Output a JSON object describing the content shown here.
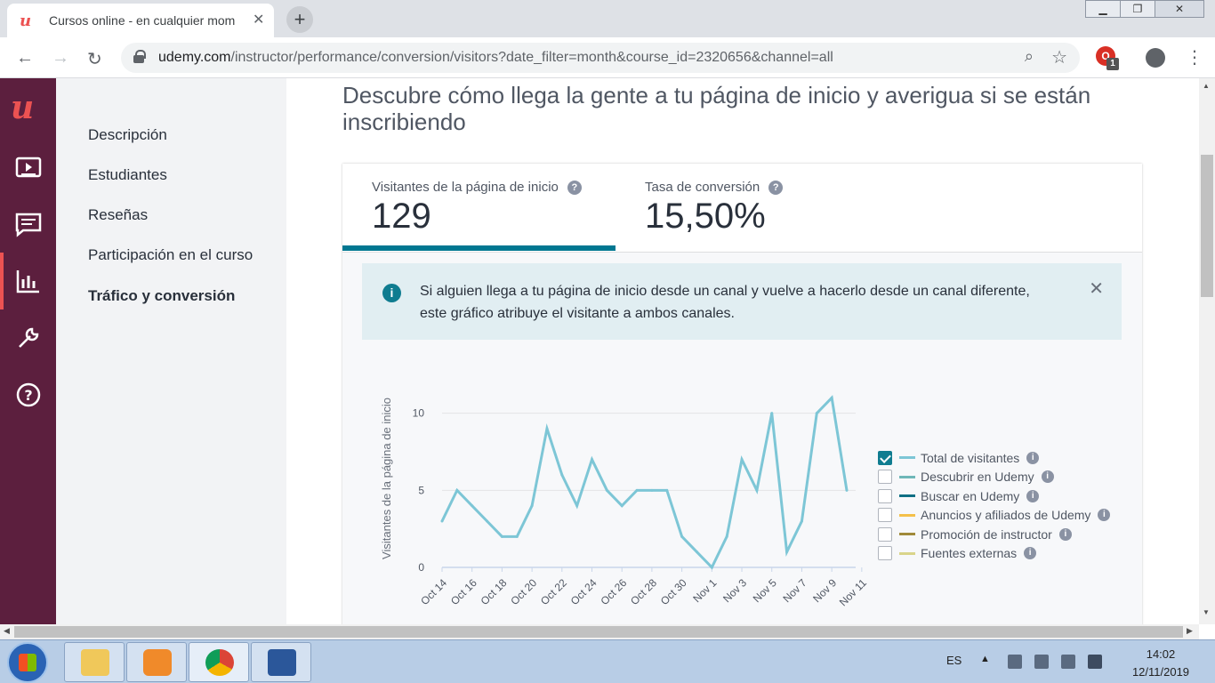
{
  "browser": {
    "tab_title": "Cursos online - en cualquier mom",
    "url_host": "udemy.com",
    "url_path": "/instructor/performance/conversion/visitors?date_filter=month&course_id=2320656&channel=all",
    "extension_badge": "1"
  },
  "nav": {
    "items": [
      {
        "label": "Descripción"
      },
      {
        "label": "Estudiantes"
      },
      {
        "label": "Reseñas"
      },
      {
        "label": "Participación en el curso"
      },
      {
        "label": "Tráfico y conversión"
      }
    ]
  },
  "main": {
    "headline": "Descubre cómo llega la gente a tu página de inicio y averigua si se están inscribiendo",
    "stats": [
      {
        "label": "Visitantes de la página de inicio",
        "value": "129"
      },
      {
        "label": "Tasa de conversión",
        "value": "15,50%"
      }
    ],
    "info": "Si alguien llega a tu página de inicio desde un canal y vuelve a hacerlo desde un canal diferente, este gráfico atribuye el visitante a ambos canales."
  },
  "chart_data": {
    "type": "line",
    "ylabel": "Visitantes de la página de inicio",
    "ylim": [
      0,
      10
    ],
    "yticks": [
      0,
      5,
      10
    ],
    "x_ticks": [
      "Oct 14",
      "Oct 16",
      "Oct 18",
      "Oct 20",
      "Oct 22",
      "Oct 24",
      "Oct 26",
      "Oct 28",
      "Oct 30",
      "Nov 1",
      "Nov 3",
      "Nov 5",
      "Nov 7",
      "Nov 9",
      "Nov 11"
    ],
    "x": [
      "Oct 14",
      "Oct 15",
      "Oct 16",
      "Oct 17",
      "Oct 18",
      "Oct 19",
      "Oct 20",
      "Oct 21",
      "Oct 22",
      "Oct 23",
      "Oct 24",
      "Oct 25",
      "Oct 26",
      "Oct 27",
      "Oct 28",
      "Oct 29",
      "Oct 30",
      "Oct 31",
      "Nov 1",
      "Nov 2",
      "Nov 3",
      "Nov 4",
      "Nov 5",
      "Nov 6",
      "Nov 7",
      "Nov 8",
      "Nov 9",
      "Nov 10"
    ],
    "series": [
      {
        "name": "Total de visitantes",
        "color": "#7dc6d6",
        "values": [
          3,
          5,
          4,
          3,
          2,
          2,
          4,
          9,
          6,
          4,
          7,
          5,
          4,
          5,
          5,
          5,
          2,
          1,
          0,
          2,
          7,
          5,
          10,
          1,
          3,
          10,
          11,
          5
        ]
      }
    ],
    "grid": true,
    "legend_position": "right",
    "legend": [
      {
        "label": "Total de visitantes",
        "color": "#7dc6d6",
        "checked": true
      },
      {
        "label": "Descubrir en Udemy",
        "color": "#6fb7b8",
        "checked": false
      },
      {
        "label": "Buscar en Udemy",
        "color": "#0f6f84",
        "checked": false
      },
      {
        "label": "Anuncios y afiliados de Udemy",
        "color": "#f4c04a",
        "checked": false
      },
      {
        "label": "Promoción de instructor",
        "color": "#a08a3a",
        "checked": false
      },
      {
        "label": "Fuentes externas",
        "color": "#d9d48a",
        "checked": false
      }
    ]
  },
  "taskbar": {
    "lang": "ES",
    "time": "14:02",
    "date": "12/11/2019"
  }
}
